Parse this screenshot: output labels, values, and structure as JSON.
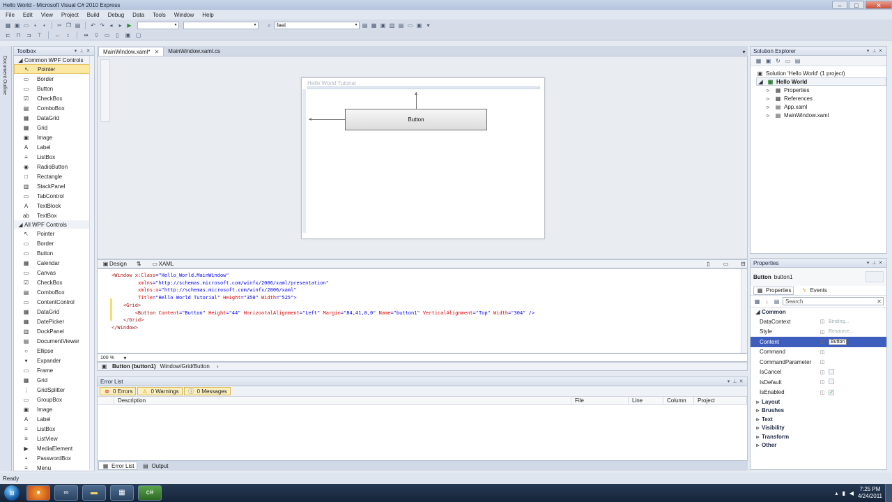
{
  "window": {
    "title": "Hello World - Microsoft Visual C# 2010 Express"
  },
  "menu": [
    "File",
    "Edit",
    "View",
    "Project",
    "Build",
    "Debug",
    "Data",
    "Tools",
    "Window",
    "Help"
  ],
  "toolbar": {
    "find_value": "feel"
  },
  "toolbox": {
    "title": "Toolbox",
    "groups": [
      {
        "label": "Common WPF Controls",
        "items": [
          {
            "label": "Pointer",
            "icon": "↖"
          },
          {
            "label": "Border",
            "icon": "▭"
          },
          {
            "label": "Button",
            "icon": "▭"
          },
          {
            "label": "CheckBox",
            "icon": "☑"
          },
          {
            "label": "ComboBox",
            "icon": "▤"
          },
          {
            "label": "DataGrid",
            "icon": "▦"
          },
          {
            "label": "Grid",
            "icon": "▦"
          },
          {
            "label": "Image",
            "icon": "▣"
          },
          {
            "label": "Label",
            "icon": "A"
          },
          {
            "label": "ListBox",
            "icon": "≡"
          },
          {
            "label": "RadioButton",
            "icon": "◉"
          },
          {
            "label": "Rectangle",
            "icon": "□"
          },
          {
            "label": "StackPanel",
            "icon": "▥"
          },
          {
            "label": "TabControl",
            "icon": "▭"
          },
          {
            "label": "TextBlock",
            "icon": "A"
          },
          {
            "label": "TextBox",
            "icon": "ab"
          }
        ]
      },
      {
        "label": "All WPF Controls",
        "items": [
          {
            "label": "Pointer",
            "icon": "↖"
          },
          {
            "label": "Border",
            "icon": "▭"
          },
          {
            "label": "Button",
            "icon": "▭"
          },
          {
            "label": "Calendar",
            "icon": "▦"
          },
          {
            "label": "Canvas",
            "icon": "▭"
          },
          {
            "label": "CheckBox",
            "icon": "☑"
          },
          {
            "label": "ComboBox",
            "icon": "▤"
          },
          {
            "label": "ContentControl",
            "icon": "▭"
          },
          {
            "label": "DataGrid",
            "icon": "▦"
          },
          {
            "label": "DatePicker",
            "icon": "▦"
          },
          {
            "label": "DockPanel",
            "icon": "▥"
          },
          {
            "label": "DocumentViewer",
            "icon": "▤"
          },
          {
            "label": "Ellipse",
            "icon": "○"
          },
          {
            "label": "Expander",
            "icon": "▾"
          },
          {
            "label": "Frame",
            "icon": "▭"
          },
          {
            "label": "Grid",
            "icon": "▦"
          },
          {
            "label": "GridSplitter",
            "icon": "⋮"
          },
          {
            "label": "GroupBox",
            "icon": "▭"
          },
          {
            "label": "Image",
            "icon": "▣"
          },
          {
            "label": "Label",
            "icon": "A"
          },
          {
            "label": "ListBox",
            "icon": "≡"
          },
          {
            "label": "ListView",
            "icon": "≡"
          },
          {
            "label": "MediaElement",
            "icon": "▶"
          },
          {
            "label": "PasswordBox",
            "icon": "•"
          },
          {
            "label": "Menu",
            "icon": "≡"
          }
        ]
      }
    ]
  },
  "left_strip": {
    "label": "Document Outline"
  },
  "doc_tabs": [
    {
      "label": "MainWindow.xaml*",
      "active": true
    },
    {
      "label": "MainWindow.xaml.cs",
      "active": false
    }
  ],
  "designer": {
    "window_title": "Hello World Tutorial",
    "button_label": "Button"
  },
  "split": {
    "design_tab": "Design",
    "swap_icon": "⇅",
    "xaml_tab": "XAML"
  },
  "xaml_lines": [
    {
      "tag": "<Window",
      "attrs": [
        [
          "x:Class",
          "\"Hello_World.MainWindow\""
        ]
      ]
    },
    {
      "indent": "        ",
      "attrs": [
        [
          "xmlns",
          "\"http://schemas.microsoft.com/winfx/2006/xaml/presentation\""
        ]
      ]
    },
    {
      "indent": "        ",
      "attrs": [
        [
          "xmlns:x",
          "\"http://schemas.microsoft.com/winfx/2006/xaml\""
        ]
      ]
    },
    {
      "indent": "        ",
      "attrs": [
        [
          "Title",
          "\"Hello World Tutorial\""
        ],
        [
          "Height",
          "\"350\""
        ],
        [
          "Width",
          "\"525\""
        ]
      ],
      "end": ">"
    },
    {
      "indent": "    ",
      "tag": "<Grid>"
    },
    {
      "indent": "        ",
      "tag": "<Button",
      "attrs": [
        [
          "Content",
          "\"Button\""
        ],
        [
          "Height",
          "\"44\""
        ],
        [
          "HorizontalAlignment",
          "\"Left\""
        ],
        [
          "Margin",
          "\"84,41,0,0\""
        ],
        [
          "Name",
          "\"button1\""
        ],
        [
          "VerticalAlignment",
          "\"Top\""
        ],
        [
          "Width",
          "\"304\""
        ]
      ],
      "end": " />"
    },
    {
      "indent": "    ",
      "tag": "</Grid>"
    },
    {
      "tag": "</Window>"
    }
  ],
  "xaml_zoom": "100 %",
  "breadcrumb": {
    "object": "Button (button1)",
    "path": "Window/Grid/Button"
  },
  "error_list": {
    "title": "Error List",
    "filters": {
      "errors": "0 Errors",
      "warnings": "0 Warnings",
      "messages": "0 Messages"
    },
    "columns": [
      "Description",
      "File",
      "Line",
      "Column",
      "Project"
    ]
  },
  "bottom_tabs": [
    "Error List",
    "Output"
  ],
  "solution_explorer": {
    "title": "Solution Explorer",
    "solution": "Solution 'Hello World' (1 project)",
    "project": "Hello World",
    "children": [
      "Properties",
      "References",
      "App.xaml",
      "MainWindow.xaml"
    ]
  },
  "properties": {
    "title": "Properties",
    "object_type": "Button",
    "object_name": "button1",
    "tab_properties": "Properties",
    "tab_events": "Events",
    "search_placeholder": "Search",
    "category_common": "Common",
    "rows": [
      {
        "name": "DataContext",
        "value": "Binding..."
      },
      {
        "name": "Style",
        "value": "Resource..."
      },
      {
        "name": "Content",
        "value": "Button",
        "selected": true
      },
      {
        "name": "Command",
        "value": ""
      },
      {
        "name": "CommandParameter",
        "value": ""
      },
      {
        "name": "IsCancel",
        "check": false
      },
      {
        "name": "IsDefault",
        "check": false
      },
      {
        "name": "IsEnabled",
        "check": true
      }
    ],
    "categories": [
      "Layout",
      "Brushes",
      "Text",
      "Visibility",
      "Transform",
      "Other"
    ]
  },
  "status": {
    "text": "Ready"
  },
  "taskbar": {
    "time": "7:25 PM",
    "date": "4/24/2011",
    "apps": [
      "firefox",
      "vs-express",
      "folder",
      "explorer",
      "csharp"
    ]
  }
}
